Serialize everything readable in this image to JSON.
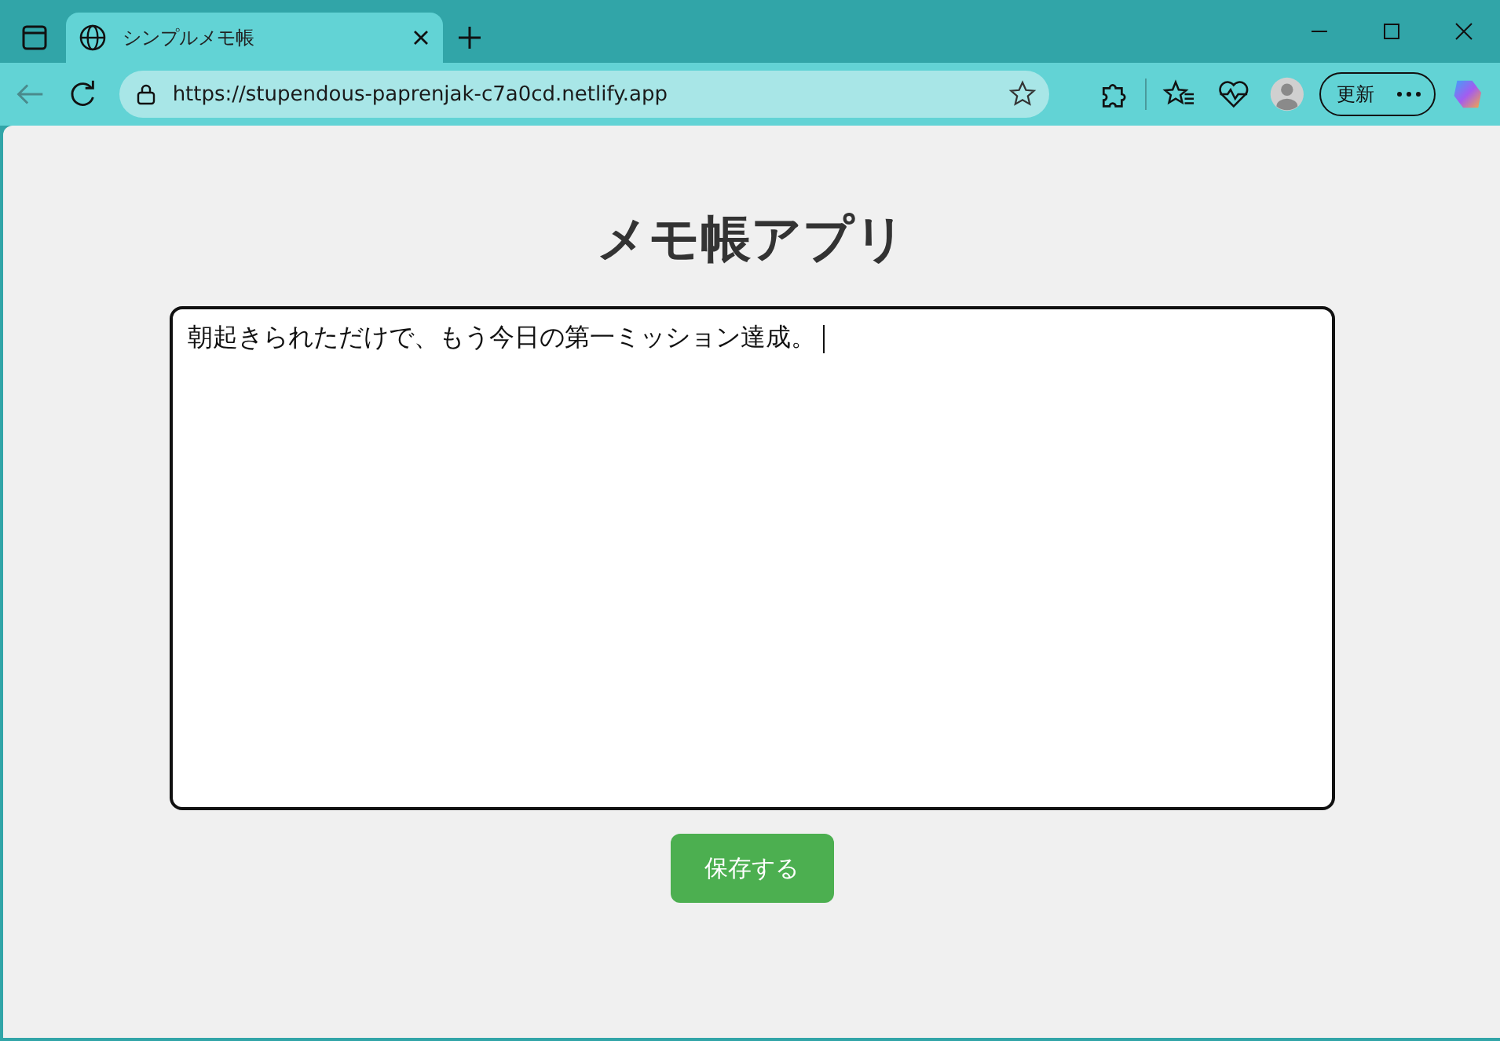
{
  "browser": {
    "tab": {
      "title": "シンプルメモ帳",
      "selected": true
    },
    "url": "https://stupendous-paprenjak-c7a0cd.netlify.app",
    "update_button": "更新"
  },
  "page": {
    "heading": "メモ帳アプリ",
    "memo": {
      "value": "朝起きられただけで、もう今日の第一ミッション達成。"
    },
    "save_button": "保存する"
  }
}
